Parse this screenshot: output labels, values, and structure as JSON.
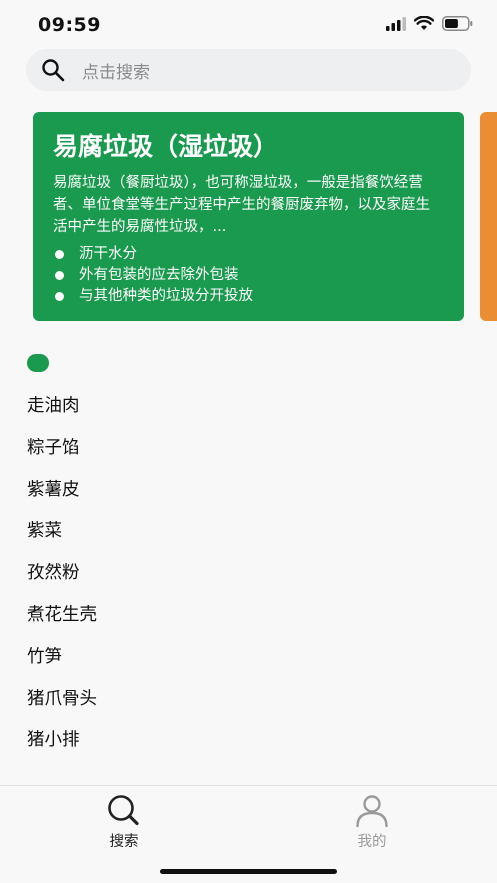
{
  "status_bar": {
    "time": "09:59",
    "battery_level": 0.6
  },
  "search": {
    "placeholder": "点击搜索"
  },
  "card": {
    "title": "易腐垃圾（湿垃圾）",
    "description": "易腐垃圾（餐厨垃圾），也可称湿垃圾，一般是指餐饮经营者、单位食堂等生产过程中产生的餐厨废弃物，以及家庭生活中产生的易腐性垃圾，...",
    "tips": [
      "沥干水分",
      "外有包装的应去除外包装",
      "与其他种类的垃圾分开投放"
    ],
    "color": "#1a9a4e",
    "next_card_color": "#ea8d33"
  },
  "items": [
    "走油肉",
    "粽子馅",
    "紫薯皮",
    "紫菜",
    "孜然粉",
    "煮花生壳",
    "竹笋",
    "猪爪骨头",
    "猪小排"
  ],
  "tabs": [
    {
      "label": "搜索",
      "icon": "search-icon",
      "active": true
    },
    {
      "label": "我的",
      "icon": "user-icon",
      "active": false
    }
  ]
}
